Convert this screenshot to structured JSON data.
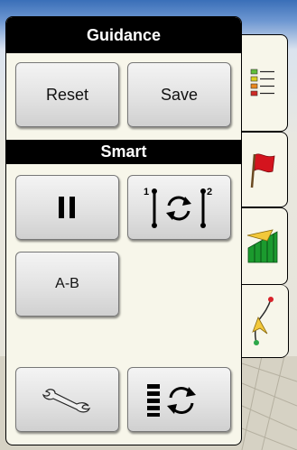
{
  "panel": {
    "title": "Guidance",
    "buttons": {
      "reset": "Reset",
      "save": "Save"
    }
  },
  "smart": {
    "title": "Smart",
    "buttons": {
      "pause_icon": "pause-icon",
      "cycle_icon": "cycle-lines-icon",
      "ab": "A-B"
    }
  },
  "bottom": {
    "settings_icon": "wrench-icon",
    "guidance_pattern_icon": "pattern-cycle-icon"
  },
  "tabs": [
    {
      "icon": "list-icon"
    },
    {
      "icon": "flag-icon"
    },
    {
      "icon": "field-map-icon"
    },
    {
      "icon": "guidance-line-icon"
    }
  ],
  "colors": {
    "panel": "#f7f6ea",
    "bar": "#000000",
    "flag_red": "#d4141e",
    "field_green": "#1b9a2e",
    "line_yellow": "#f2c83a"
  }
}
